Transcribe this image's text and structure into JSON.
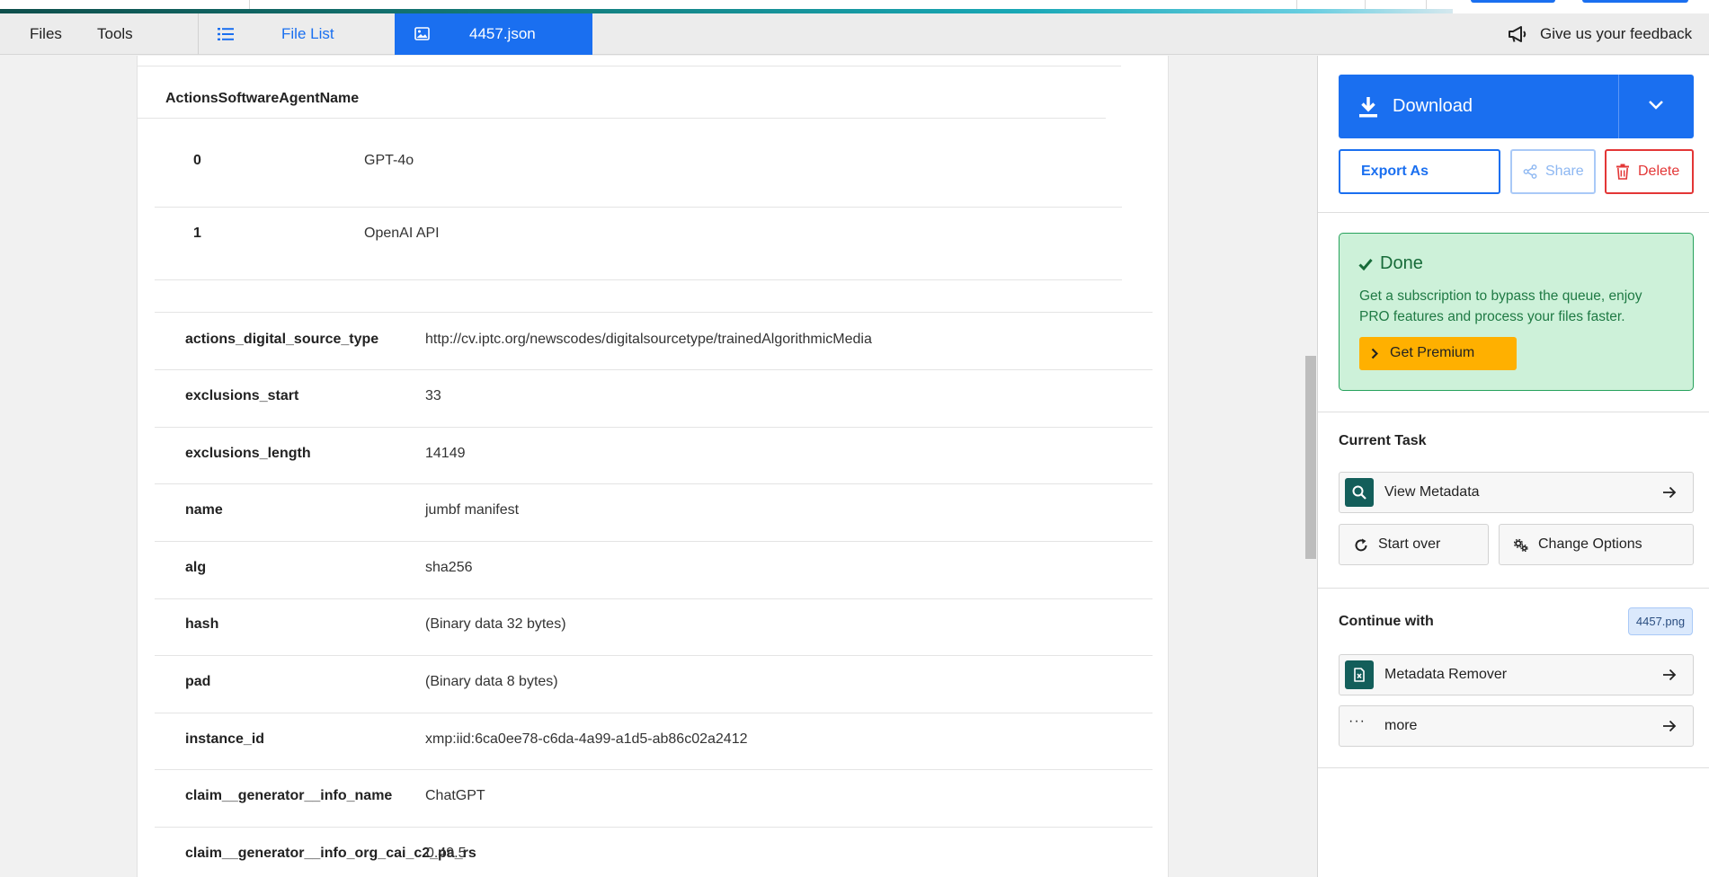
{
  "colors": {
    "accent": "#1a6ff0",
    "danger": "#e33636",
    "success_bg": "#cdf1d9",
    "success_text": "#176b39",
    "premium": "#ffb000",
    "task_badge": "#135e5a"
  },
  "progress": {
    "fraction": 0.85
  },
  "toolbar": {
    "menu": {
      "files": "Files",
      "tools": "Tools"
    },
    "tabs": {
      "file_list": {
        "label": "File List",
        "icon": "list-icon"
      },
      "current_file": {
        "label": "4457.json",
        "icon": "image-icon"
      }
    },
    "feedback": {
      "label": "Give us your feedback",
      "icon": "megaphone-icon"
    }
  },
  "metadata": {
    "section_title": "ActionsSoftwareAgentName",
    "software_agents": [
      {
        "index": "0",
        "value": "GPT-4o"
      },
      {
        "index": "1",
        "value": "OpenAI API"
      }
    ],
    "rows": [
      {
        "key": "actions_digital_source_type",
        "value": "http://cv.iptc.org/newscodes/digitalsourcetype/trainedAlgorithmicMedia"
      },
      {
        "key": "exclusions_start",
        "value": "33"
      },
      {
        "key": "exclusions_length",
        "value": "14149"
      },
      {
        "key": "name",
        "value": "jumbf manifest"
      },
      {
        "key": "alg",
        "value": "sha256"
      },
      {
        "key": "hash",
        "value": "(Binary data 32 bytes)"
      },
      {
        "key": "pad",
        "value": "(Binary data 8 bytes)"
      },
      {
        "key": "instance_id",
        "value": "xmp:iid:6ca0ee78-c6da-4a99-a1d5-ab86c02a2412"
      },
      {
        "key": "claim__generator__info_name",
        "value": "ChatGPT"
      },
      {
        "key": "claim__generator__info_org_cai_c2_pa_rs",
        "value": "0.49.5"
      }
    ]
  },
  "panel": {
    "download": {
      "label": "Download",
      "icon": "download-icon",
      "caret_icon": "chevron-down-icon"
    },
    "export_as": "Export As",
    "share": {
      "label": "Share",
      "icon": "share-icon"
    },
    "delete": {
      "label": "Delete",
      "icon": "trash-icon"
    },
    "status": {
      "title": "Done",
      "icon": "check-icon",
      "message": "Get a subscription to bypass the queue, enjoy PRO features and process your files faster.",
      "premium_label": "Get Premium"
    },
    "current_task": {
      "heading": "Current Task",
      "task": {
        "label": "View Metadata",
        "icon": "search-icon"
      },
      "start_over": {
        "label": "Start over",
        "icon": "refresh-icon"
      },
      "change_options": {
        "label": "Change Options",
        "icon": "gears-icon"
      }
    },
    "continue_with": {
      "heading": "Continue with",
      "file_chip": "4457.png",
      "tools": [
        {
          "label": "Metadata Remover",
          "icon": "file-x-icon"
        },
        {
          "label": "more",
          "icon": "ellipsis-icon"
        }
      ]
    }
  }
}
